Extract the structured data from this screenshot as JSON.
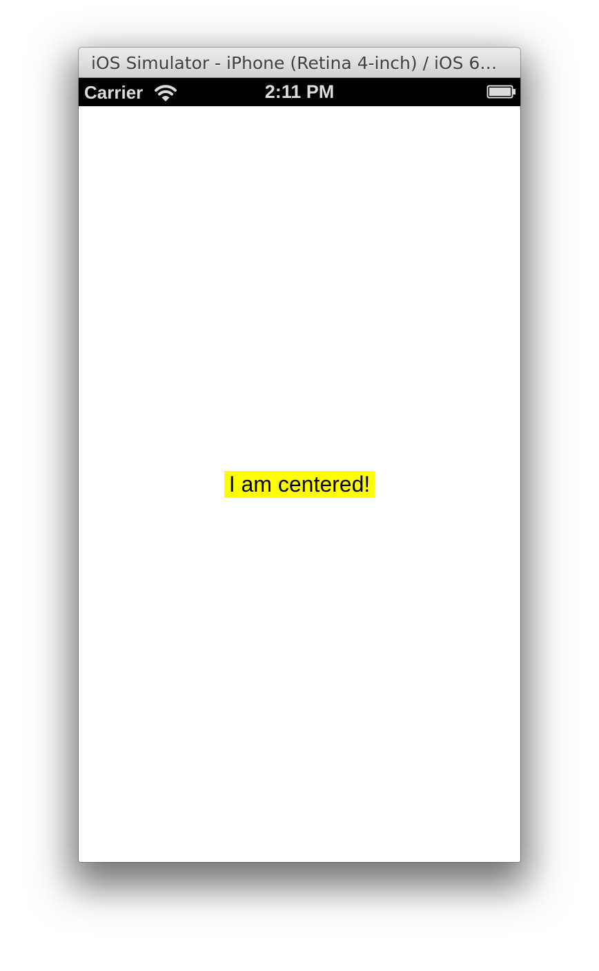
{
  "window": {
    "title": "iOS Simulator - iPhone (Retina 4-inch) / iOS 6…"
  },
  "status_bar": {
    "carrier": "Carrier",
    "time": "2:11 PM",
    "signal_icon": "wifi-icon",
    "battery_icon": "battery-icon"
  },
  "main": {
    "label_text": "I am centered!",
    "label_background": "#ffff00"
  }
}
